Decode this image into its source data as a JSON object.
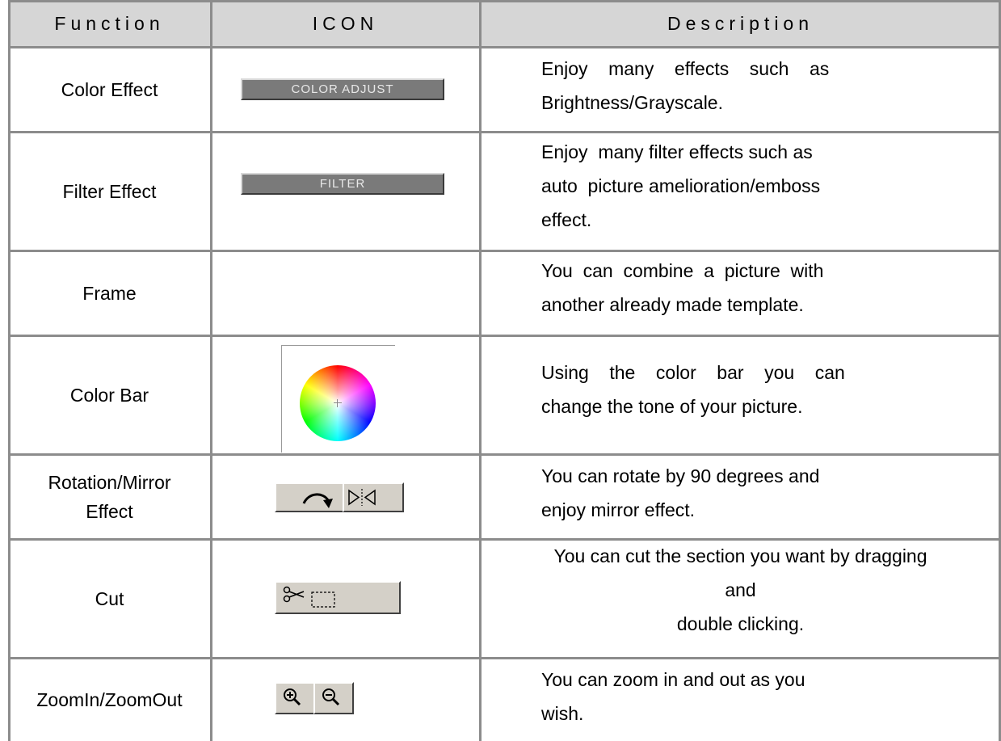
{
  "header": {
    "function": "Function",
    "icon": "ICON",
    "description": "Description"
  },
  "rows": [
    {
      "function": "Color Effect",
      "icon": {
        "type": "button",
        "label": "COLOR ADJUST",
        "name": "color-adjust-button"
      },
      "description_lines": [
        "Enjoy    many    effects    such    as",
        "Brightness/Grayscale."
      ]
    },
    {
      "function": "Filter Effect",
      "icon": {
        "type": "button",
        "label": "FILTER",
        "name": "filter-button"
      },
      "description_lines": [
        "Enjoy  many filter effects such as",
        "auto  picture amelioration/emboss",
        "effect."
      ]
    },
    {
      "function": "Frame",
      "icon": null,
      "description_lines": [
        "You  can  combine  a  picture  with",
        "another already made template."
      ]
    },
    {
      "function": "Color Bar",
      "icon": {
        "type": "color-wheel",
        "name": "color-wheel-icon"
      },
      "description_lines": [
        "Using    the    color    bar    you    can",
        "change the tone of your picture."
      ]
    },
    {
      "function_lines": [
        "Rotation/Mirror",
        "Effect"
      ],
      "icon": {
        "type": "rotate-mirror",
        "names": [
          "rotate-icon",
          "mirror-icon"
        ]
      },
      "description_lines": [
        "You can rotate by 90 degrees and",
        "enjoy mirror effect."
      ]
    },
    {
      "function": "Cut",
      "icon": {
        "type": "cut",
        "name": "cut-icon"
      },
      "description_lines": [
        "You can cut the section you want by dragging",
        "and",
        "double clicking."
      ]
    },
    {
      "function": "ZoomIn/ZoomOut",
      "icon": {
        "type": "zoom",
        "names": [
          "zoom-in-icon",
          "zoom-out-icon"
        ]
      },
      "description_lines": [
        "You can zoom in and out as you",
        "wish."
      ]
    }
  ],
  "colors": {
    "header_bg": "#d6d6d6",
    "grid": "#8c8c8c",
    "button_grey": "#7a7a7a",
    "toolbar_grey": "#d4d0c8"
  }
}
